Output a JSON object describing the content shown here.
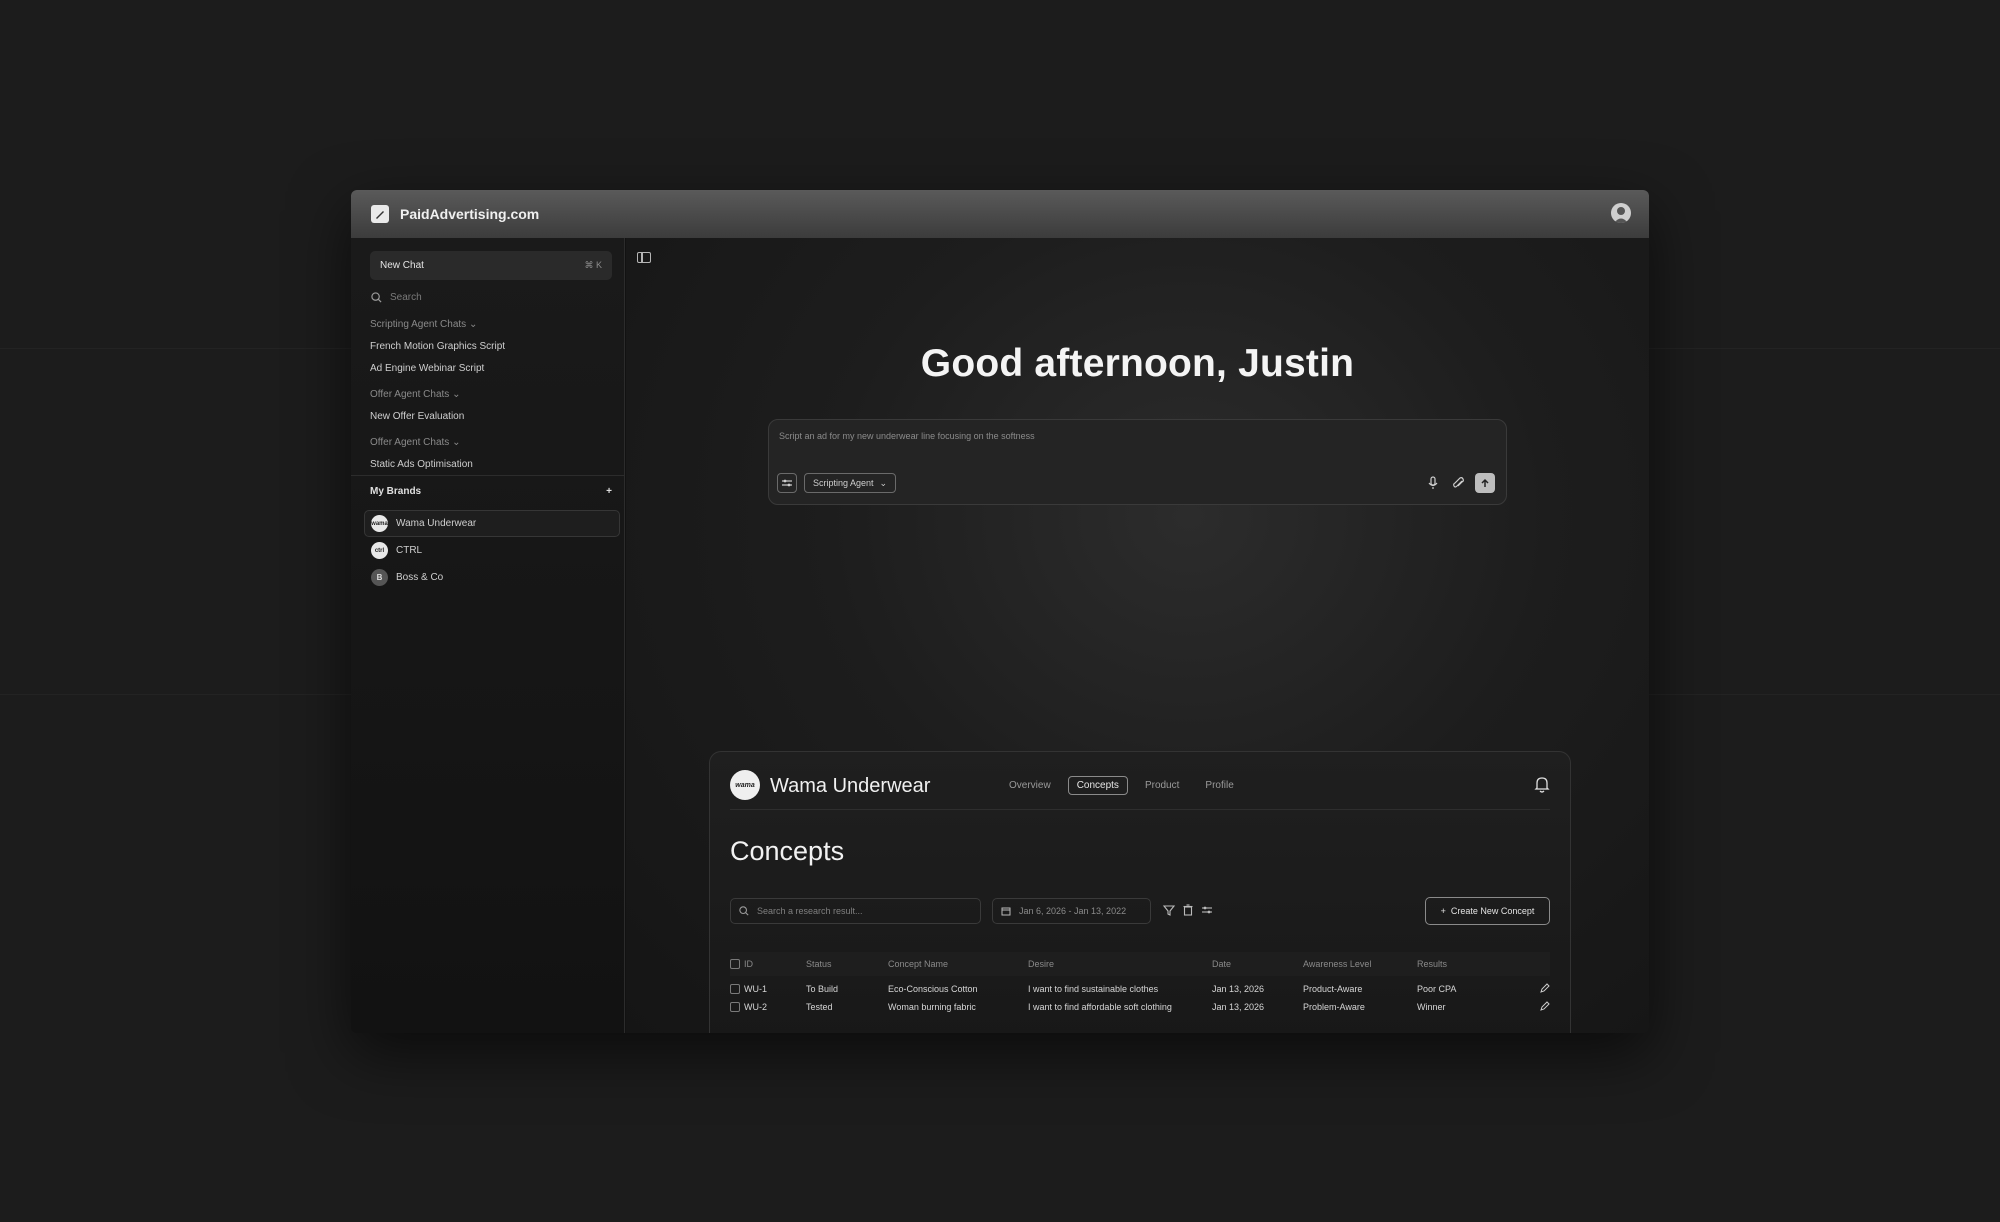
{
  "app": {
    "brand": "PaidAdvertising.com"
  },
  "sidebar": {
    "new_chat": "New Chat",
    "new_chat_shortcut": "⌘ K",
    "search_placeholder": "Search",
    "groups": [
      {
        "label": "Scripting Agent Chats",
        "items": [
          "French Motion Graphics Script",
          "Ad Engine Webinar Script"
        ]
      },
      {
        "label": "Offer Agent Chats",
        "items": [
          "New Offer Evaluation"
        ]
      },
      {
        "label": "Offer Agent Chats",
        "items": [
          "Static Ads Optimisation"
        ]
      }
    ],
    "my_brands_label": "My Brands",
    "add_label": "+",
    "brands": [
      {
        "name": "Wama Underwear",
        "avatar": "wama"
      },
      {
        "name": "CTRL",
        "avatar": "ctrl"
      },
      {
        "name": "Boss & Co",
        "avatar": "B"
      }
    ]
  },
  "main": {
    "greeting": "Good afternoon, Justin",
    "prompt": {
      "placeholder": "Script an ad for my new underwear line focusing on the softness",
      "agent": "Scripting Agent"
    }
  },
  "workspace": {
    "brand_name": "Wama Underwear",
    "logo_text": "wama",
    "tabs": [
      "Overview",
      "Concepts",
      "Product",
      "Profile"
    ],
    "active_tab": "Concepts",
    "title": "Concepts",
    "search_placeholder": "Search a research result...",
    "date_range": "Jan 6, 2026 - Jan 13, 2022",
    "create_button": "Create New Concept",
    "columns": [
      "ID",
      "Status",
      "Concept Name",
      "Desire",
      "Date",
      "Awareness Level",
      "Results"
    ],
    "rows": [
      {
        "id": "WU-1",
        "status": "To Build",
        "name": "Eco-Conscious Cotton",
        "desire": "I want to find sustainable clothes",
        "date": "Jan 13, 2026",
        "awareness": "Product-Aware",
        "results": "Poor CPA"
      },
      {
        "id": "WU-2",
        "status": "Tested",
        "name": "Woman burning fabric",
        "desire": "I want to find affordable soft clothing",
        "date": "Jan 13, 2026",
        "awareness": "Problem-Aware",
        "results": "Winner"
      }
    ]
  },
  "colors": {
    "background": "#1c1c1c",
    "window": "#121212",
    "accent_text": "#f4f4f4"
  }
}
